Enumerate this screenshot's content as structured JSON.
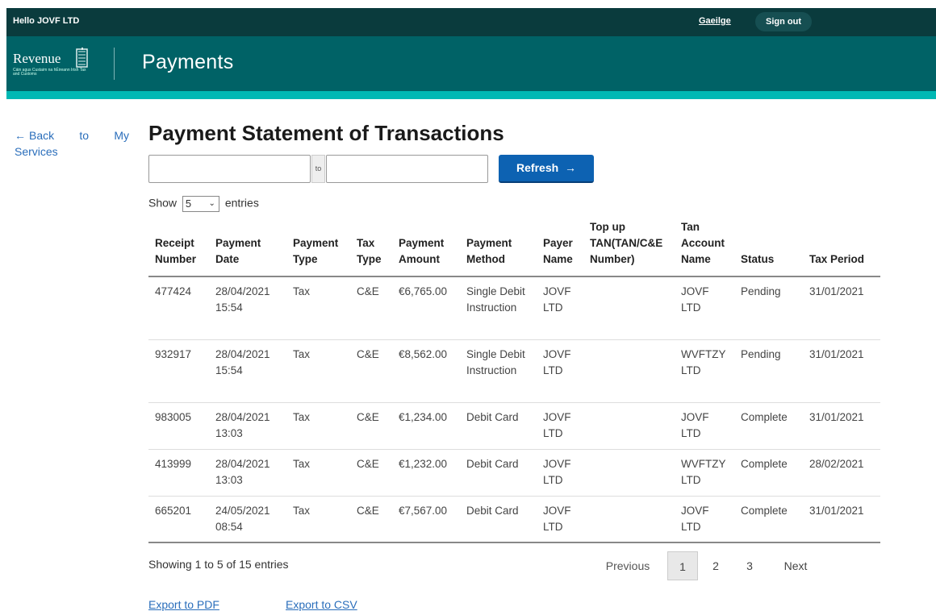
{
  "topbar": {
    "greeting": "Hello JOVF LTD",
    "language_link": "Gaeilge",
    "signout_label": "Sign out"
  },
  "header": {
    "logo_text": "Revenue",
    "logo_subtitle": "Cáin agus Custaim na hÉireann Irish Tax and Customs",
    "title": "Payments",
    "accent_color": "#00b8b4",
    "bg_color": "#006266"
  },
  "nav": {
    "back_label": "Back to My Services",
    "back_icon": "arrow-left-icon"
  },
  "main": {
    "title": "Payment Statement of Transactions",
    "date_from": {
      "value": "",
      "placeholder": ""
    },
    "to_label": "to",
    "date_to": {
      "value": "",
      "placeholder": ""
    },
    "refresh_label": "Refresh",
    "refresh_icon": "arrow-right-icon",
    "show_label": "Show",
    "entries_label": "entries",
    "page_size": "5"
  },
  "table": {
    "headers": [
      "Receipt Number",
      "Payment Date",
      "Payment Type",
      "Tax Type",
      "Payment Amount",
      "Payment Method",
      "Payer Name",
      "Top up TAN(TAN/C&E Number)",
      "Tan Account Name",
      "Status",
      "Tax Period"
    ],
    "rows": [
      [
        "477424",
        "28/04/2021 15:54",
        "Tax",
        "C&E",
        "€6,765.00",
        "Single Debit Instruction",
        "JOVF LTD",
        "",
        "JOVF LTD",
        "Pending",
        "31/01/2021"
      ],
      [
        "932917",
        "28/04/2021 15:54",
        "Tax",
        "C&E",
        "€8,562.00",
        "Single Debit Instruction",
        "JOVF LTD",
        "",
        "WVFTZY LTD",
        "Pending",
        "31/01/2021"
      ],
      [
        "983005",
        "28/04/2021 13:03",
        "Tax",
        "C&E",
        "€1,234.00",
        "Debit Card",
        "JOVF LTD",
        "",
        "JOVF LTD",
        "Complete",
        "31/01/2021"
      ],
      [
        "413999",
        "28/04/2021 13:03",
        "Tax",
        "C&E",
        "€1,232.00",
        "Debit Card",
        "JOVF LTD",
        "",
        "WVFTZY LTD",
        "Complete",
        "28/02/2021"
      ],
      [
        "665201",
        "24/05/2021 08:54",
        "Tax",
        "C&E",
        "€7,567.00",
        "Debit Card",
        "JOVF LTD",
        "",
        "JOVF LTD",
        "Complete",
        "31/01/2021"
      ]
    ]
  },
  "footer": {
    "info": "Showing 1 to 5 of 15 entries",
    "pagination": {
      "previous": "Previous",
      "pages": [
        "1",
        "2",
        "3"
      ],
      "current": "1",
      "next": "Next"
    },
    "export_pdf": "Export to PDF",
    "export_csv": "Export to CSV"
  }
}
